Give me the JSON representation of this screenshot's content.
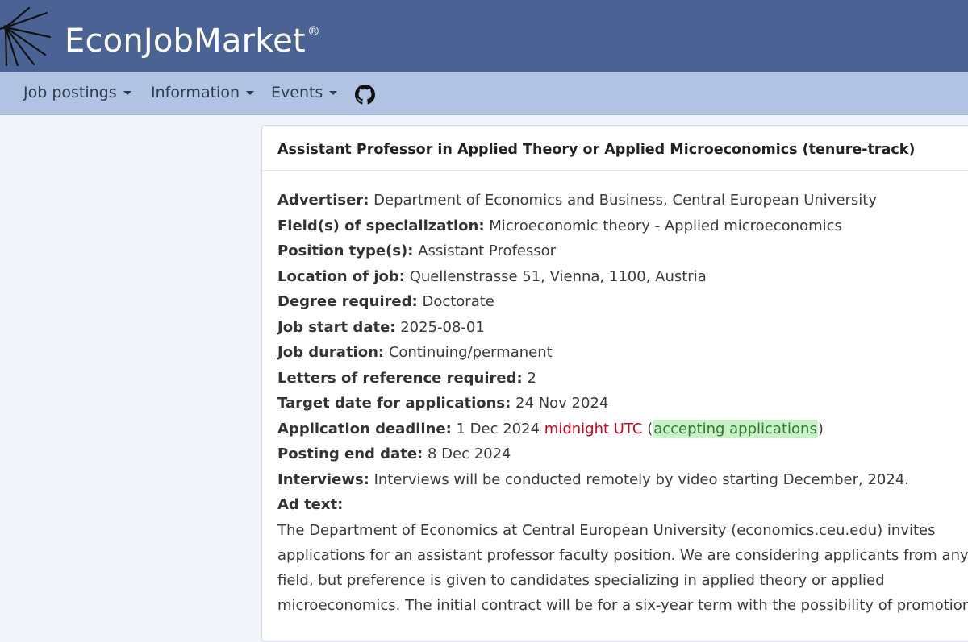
{
  "brand": {
    "name": "EconJobMarket",
    "registered": "®"
  },
  "nav": {
    "items": [
      {
        "label": "Job postings"
      },
      {
        "label": "Information"
      },
      {
        "label": "Events"
      }
    ],
    "github_icon": "github-icon"
  },
  "posting": {
    "title": "Assistant Professor in Applied Theory or Applied Microeconomics (tenure-track)",
    "fields": {
      "advertiser": {
        "label": "Advertiser:",
        "value": "Department of Economics and Business, Central European University"
      },
      "specialization": {
        "label": "Field(s) of specialization:",
        "value": "Microeconomic theory - Applied microeconomics"
      },
      "position_type": {
        "label": "Position type(s):",
        "value": "Assistant Professor"
      },
      "location": {
        "label": "Location of job:",
        "value": "Quellenstrasse 51, Vienna, 1100, Austria"
      },
      "degree": {
        "label": "Degree required:",
        "value": "Doctorate"
      },
      "start_date": {
        "label": "Job start date:",
        "value": "2025-08-01"
      },
      "duration": {
        "label": "Job duration:",
        "value": "Continuing/permanent"
      },
      "letters": {
        "label": "Letters of reference required:",
        "value": "2"
      },
      "target_date": {
        "label": "Target date for applications:",
        "value": "24 Nov 2024"
      },
      "deadline": {
        "label": "Application deadline:",
        "date": "1 Dec 2024",
        "time": "midnight UTC",
        "paren_open": "(",
        "status": "accepting applications",
        "paren_close": ")"
      },
      "end_date": {
        "label": "Posting end date:",
        "value": "8 Dec 2024"
      },
      "interviews": {
        "label": "Interviews:",
        "value": "Interviews will be conducted remotely by video starting December, 2024."
      },
      "ad_text_label": "Ad text:"
    },
    "ad_text_lines": [
      "The Department of Economics at Central European University (economics.ceu.edu) invites",
      "applications for an assistant professor faculty position. We are considering applicants from any",
      "field, but preference is given to candidates specializing in applied theory or applied",
      "microeconomics. The initial contract will be for a six-year term with the possibility of promotion to"
    ]
  },
  "colors": {
    "header": "#4a6394",
    "navbar": "#b0c3e2",
    "deadline_red": "#d0021b",
    "status_green_bg": "#c9f1c7"
  }
}
